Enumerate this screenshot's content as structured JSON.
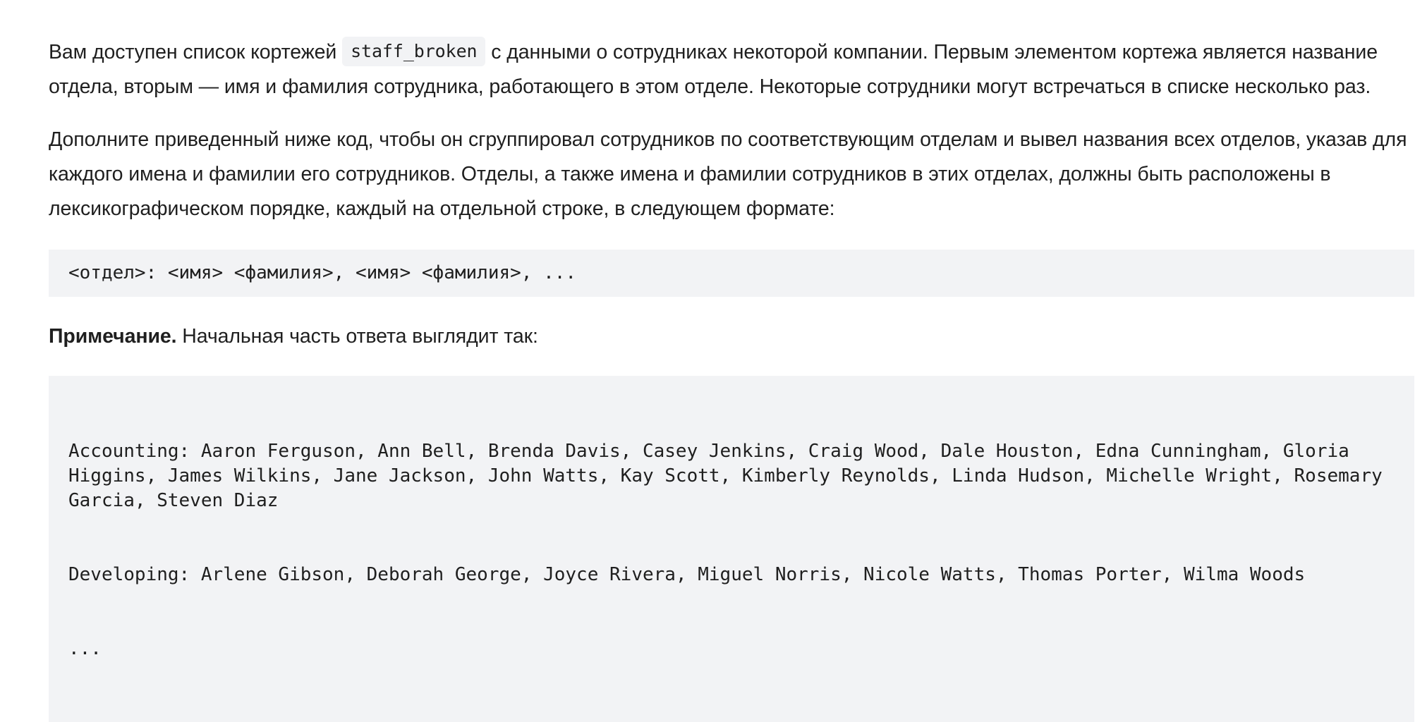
{
  "paragraph1": {
    "before": "Вам доступен список кортежей ",
    "code": "staff_broken",
    "after": " с данными о сотрудниках некоторой компании. Первым элементом кортежа является название отдела, вторым — имя и фамилия сотрудника, работающего в этом отделе. Некоторые сотрудники могут встречаться в списке несколько раз."
  },
  "paragraph2": "Дополните приведенный ниже код, чтобы он сгруппировал сотрудников по соответствующим отделам и вывел названия всех отделов, указав для каждого имена и фамилии его сотрудников. Отделы, а также имена и фамилии сотрудников в этих отделах, должны быть расположены в лексикографическом порядке, каждый на отдельной строке, в следующем формате:",
  "format_code": "<отдел>: <имя> <фамилия>, <имя> <фамилия>, ...",
  "note": {
    "label": "Примечание.",
    "text": " Начальная часть ответа выглядит так:"
  },
  "sample_output": {
    "line1": "Accounting: Aaron Ferguson, Ann Bell, Brenda Davis, Casey Jenkins, Craig Wood, Dale Houston, Edna Cunningham, Gloria Higgins, James Wilkins, Jane Jackson, John Watts, Kay Scott, Kimberly Reynolds, Linda Hudson, Michelle Wright, Rosemary Garcia, Steven Diaz",
    "line2": "Developing: Arlene Gibson, Deborah George, Joyce Rivera, Miguel Norris, Nicole Watts, Thomas Porter, Wilma Woods",
    "line3": "..."
  }
}
